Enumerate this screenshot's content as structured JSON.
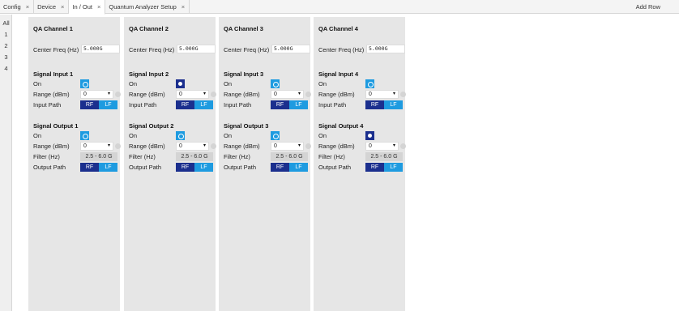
{
  "tabs": [
    {
      "label": "Config",
      "close": "×",
      "active": false
    },
    {
      "label": "Device",
      "close": "×",
      "active": false
    },
    {
      "label": "In / Out",
      "close": "×",
      "active": true
    },
    {
      "label": "Quantum Analyzer Setup",
      "close": "×",
      "active": false
    }
  ],
  "add_row_label": "Add Row",
  "row_tabs": [
    "All",
    "1",
    "2",
    "3",
    "4"
  ],
  "labels": {
    "center_freq": "Center Freq (Hz)",
    "on": "On",
    "range": "Range (dBm)",
    "input_path": "Input Path",
    "filter": "Filter (Hz)",
    "output_path": "Output Path",
    "rf": "RF",
    "lf": "LF",
    "dropdown_arrow": "▾"
  },
  "colors": {
    "toggle_off": "#1e9be0",
    "toggle_on": "#1b2f8e",
    "rf_selected": "#1b2f8e",
    "lf": "#1e9be0"
  },
  "channels": [
    {
      "title": "QA Channel 1",
      "center_freq": "5.000G",
      "input_title": "Signal Input 1",
      "input_on": false,
      "input_range": "0",
      "output_title": "Signal Output 1",
      "output_on": false,
      "output_range": "0",
      "filter": "2.5 - 6.0 G"
    },
    {
      "title": "QA Channel 2",
      "center_freq": "5.000G",
      "input_title": "Signal Input 2",
      "input_on": true,
      "input_range": "0",
      "output_title": "Signal Output 2",
      "output_on": false,
      "output_range": "0",
      "filter": "2.5 - 6.0 G"
    },
    {
      "title": "QA Channel 3",
      "center_freq": "5.000G",
      "input_title": "Signal Input 3",
      "input_on": false,
      "input_range": "0",
      "output_title": "Signal Output 3",
      "output_on": false,
      "output_range": "0",
      "filter": "2.5 - 6.0 G"
    },
    {
      "title": "QA Channel 4",
      "center_freq": "5.000G",
      "input_title": "Signal Input 4",
      "input_on": false,
      "input_range": "0",
      "output_title": "Signal Output 4",
      "output_on": true,
      "output_range": "0",
      "filter": "2.5 - 6.0 G"
    }
  ]
}
